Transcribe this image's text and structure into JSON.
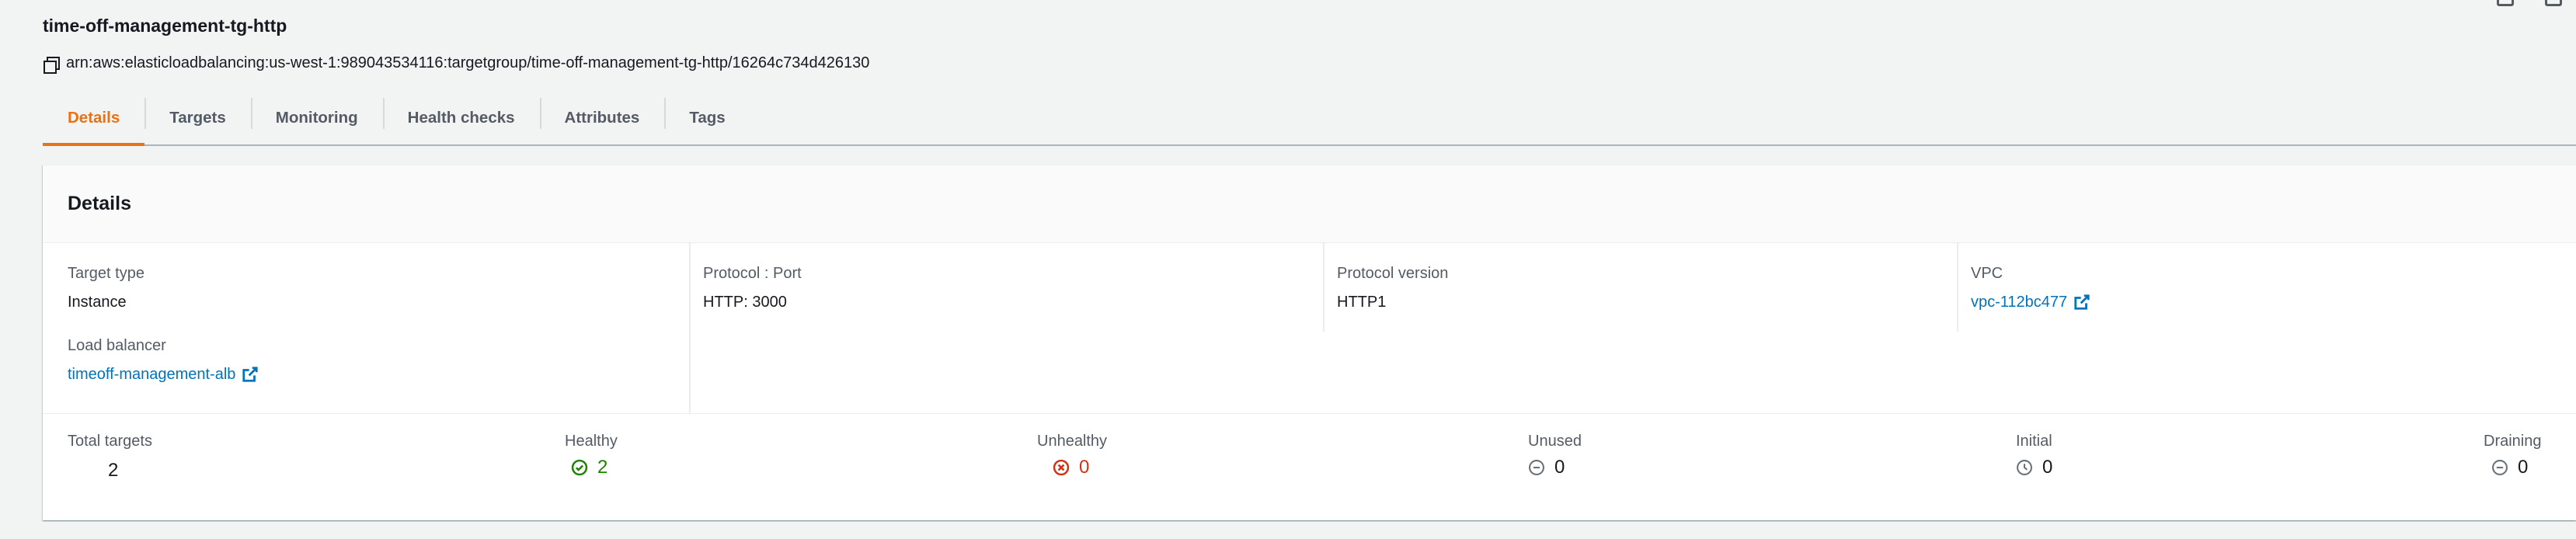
{
  "page": {
    "title": "time-off-management-tg-http",
    "arn": "arn:aws:elasticloadbalancing:us-west-1:989043534116:targetgroup/time-off-management-tg-http/16264c734d426130"
  },
  "tabs": [
    {
      "label": "Details",
      "active": true
    },
    {
      "label": "Targets"
    },
    {
      "label": "Monitoring"
    },
    {
      "label": "Health checks"
    },
    {
      "label": "Attributes"
    },
    {
      "label": "Tags"
    }
  ],
  "details": {
    "header": "Details",
    "target_type": {
      "label": "Target type",
      "value": "Instance"
    },
    "protocol_port": {
      "label": "Protocol : Port",
      "value": "HTTP: 3000"
    },
    "protocol_version": {
      "label": "Protocol version",
      "value": "HTTP1"
    },
    "vpc": {
      "label": "VPC",
      "value": "vpc-112bc477"
    },
    "load_balancer": {
      "label": "Load balancer",
      "value": "timeoff-management-alb"
    }
  },
  "stats": {
    "total": {
      "label": "Total targets",
      "value": "2"
    },
    "healthy": {
      "label": "Healthy",
      "value": "2",
      "icon": "check-circle-icon"
    },
    "unhealthy": {
      "label": "Unhealthy",
      "value": "0",
      "icon": "x-circle-icon"
    },
    "unused": {
      "label": "Unused",
      "value": "0",
      "icon": "minus-circle-icon"
    },
    "initial": {
      "label": "Initial",
      "value": "0",
      "icon": "clock-icon"
    },
    "draining": {
      "label": "Draining",
      "value": "0",
      "icon": "minus-circle-icon"
    }
  },
  "colors": {
    "accent": "#ec7211",
    "link": "#0073bb",
    "healthy": "#1d8102",
    "unhealthy": "#d13212",
    "muted": "#687078"
  }
}
